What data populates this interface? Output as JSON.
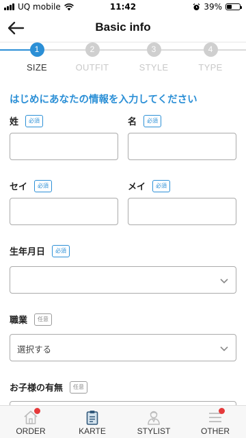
{
  "status_bar": {
    "carrier": "UQ mobile",
    "time": "11:42",
    "battery": "39%",
    "battery_level": 0.39
  },
  "header": {
    "title": "Basic info"
  },
  "steps": [
    {
      "number": "1",
      "label": "SIZE",
      "active": true
    },
    {
      "number": "2",
      "label": "OUTFIT",
      "active": false
    },
    {
      "number": "3",
      "label": "STYLE",
      "active": false
    },
    {
      "number": "4",
      "label": "TYPE",
      "active": false
    }
  ],
  "form": {
    "intro": "はじめにあなたの情報を入力してください",
    "required_badge": "必須",
    "optional_badge": "任意",
    "last_name": {
      "label": "姓",
      "value": ""
    },
    "first_name": {
      "label": "名",
      "value": ""
    },
    "last_name_kana": {
      "label": "セイ",
      "value": ""
    },
    "first_name_kana": {
      "label": "メイ",
      "value": ""
    },
    "birthday": {
      "label": "生年月日",
      "value": ""
    },
    "occupation": {
      "label": "職業",
      "value": "選択する"
    },
    "children": {
      "label": "お子様の有無"
    }
  },
  "bottom_nav": [
    {
      "label": "ORDER",
      "icon": "house-icon",
      "notification": true
    },
    {
      "label": "KARTE",
      "icon": "clipboard-icon",
      "notification": false
    },
    {
      "label": "STYLIST",
      "icon": "stylist-icon",
      "notification": false
    },
    {
      "label": "OTHER",
      "icon": "menu-icon",
      "notification": true
    }
  ],
  "colors": {
    "accent": "#2b8fd6",
    "notification": "#e5393a",
    "inactive_step": "#cfcfcf"
  }
}
